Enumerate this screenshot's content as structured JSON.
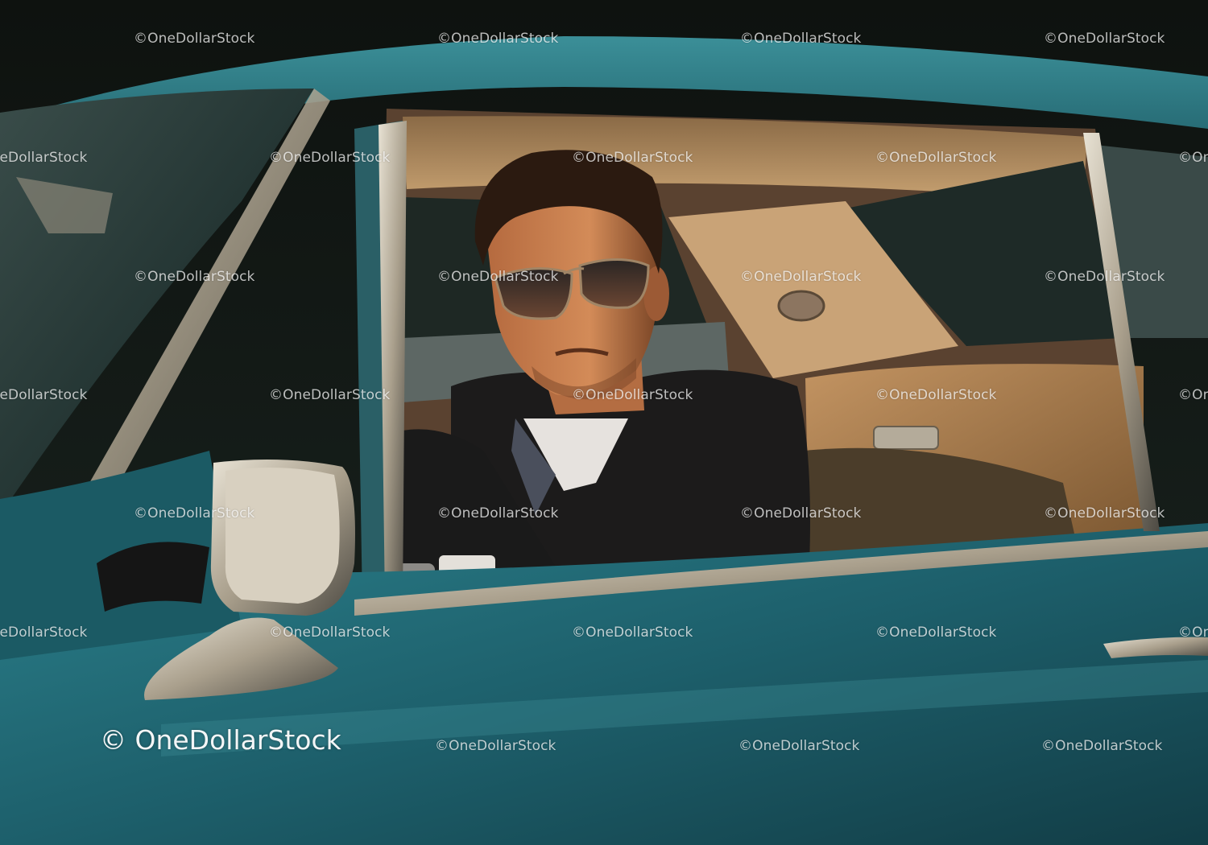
{
  "image": {
    "description_icon": "man-in-vintage-car-photo"
  },
  "watermark": {
    "large_text": "© OneDollarStock",
    "tile_text": "©OneDollarStock"
  },
  "colors": {
    "car_body": "#1f5f6a",
    "interior": "#b98a55",
    "jacket": "#1b1a1a"
  }
}
